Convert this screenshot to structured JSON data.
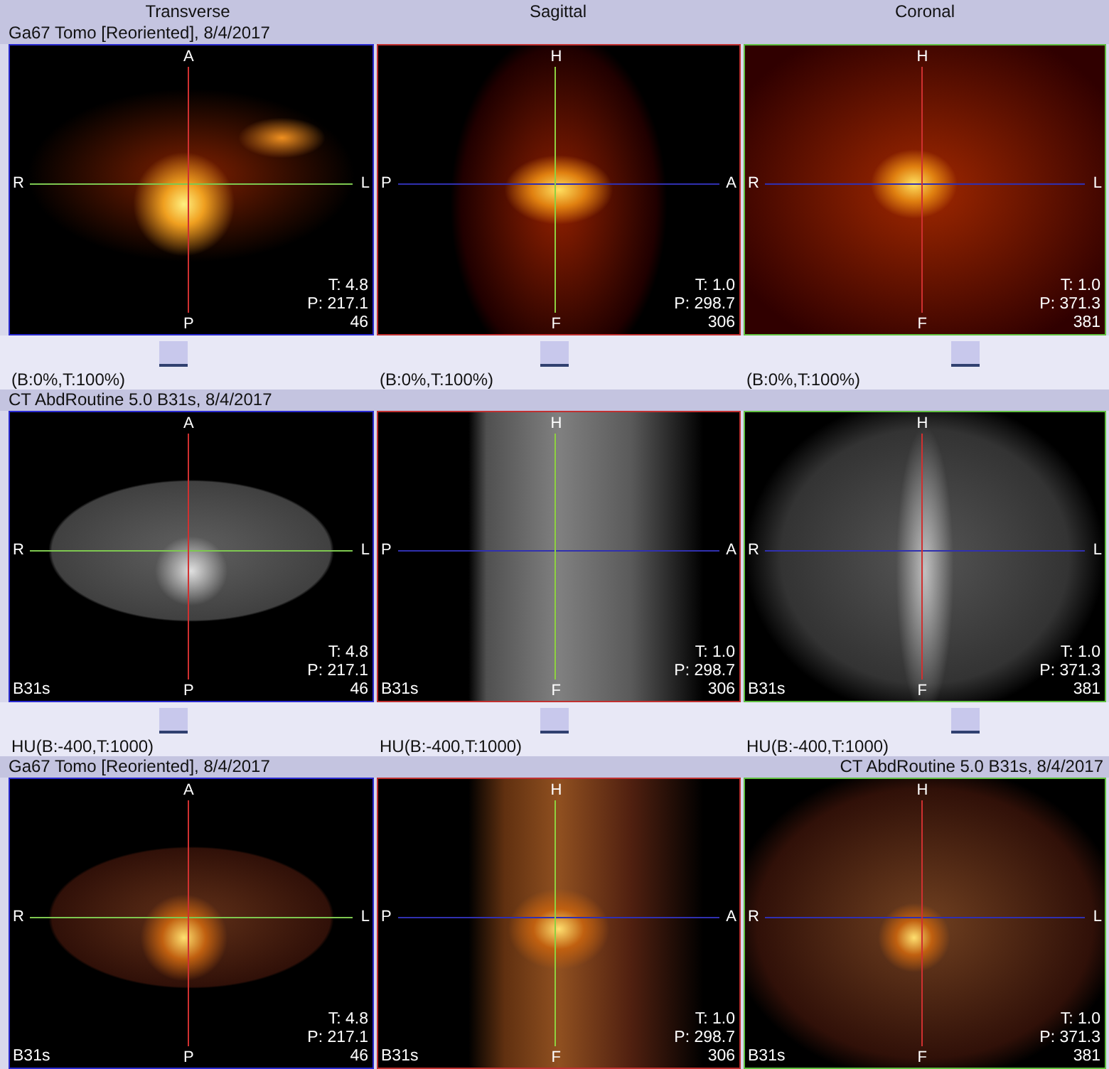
{
  "headers": [
    "Transverse",
    "Sagittal",
    "Coronal"
  ],
  "rows": [
    {
      "kind": "pet",
      "title_left": "Ga67 Tomo [Reoriented], 8/4/2017",
      "views": [
        {
          "kind": "transverse",
          "top": "A",
          "bottom": "P",
          "left": "R",
          "right": "L",
          "t": "T: 4.8",
          "p": "P: 217.1",
          "slice": "46",
          "slider": {
            "level": 0.45
          },
          "window": "(B:0%,T:100%)"
        },
        {
          "kind": "sagittal",
          "top": "H",
          "bottom": "F",
          "left": "P",
          "right": "A",
          "t": "T: 1.0",
          "p": "P: 298.7",
          "slice": "306",
          "slider": {
            "level": 0.49
          },
          "window": "(B:0%,T:100%)"
        },
        {
          "kind": "coronal",
          "top": "H",
          "bottom": "F",
          "left": "R",
          "right": "L",
          "t": "T: 1.0",
          "p": "P: 371.3",
          "slice": "381",
          "slider": {
            "level": 0.61
          },
          "window": "(B:0%,T:100%)"
        }
      ]
    },
    {
      "kind": "ct",
      "title_left": "CT AbdRoutine  5.0  B31s, 8/4/2017",
      "views": [
        {
          "kind": "transverse",
          "top": "A",
          "bottom": "P",
          "left": "R",
          "right": "L",
          "t": "T: 4.8",
          "p": "P: 217.1",
          "slice": "46",
          "series": "B31s",
          "slider": {
            "level": 0.45
          },
          "window": "HU(B:-400,T:1000)"
        },
        {
          "kind": "sagittal",
          "top": "H",
          "bottom": "F",
          "left": "P",
          "right": "A",
          "t": "T: 1.0",
          "p": "P: 298.7",
          "slice": "306",
          "series": "B31s",
          "slider": {
            "level": 0.49
          },
          "window": "HU(B:-400,T:1000)"
        },
        {
          "kind": "coronal",
          "top": "H",
          "bottom": "F",
          "left": "R",
          "right": "L",
          "t": "T: 1.0",
          "p": "P: 371.3",
          "slice": "381",
          "series": "B31s",
          "slider": {
            "level": 0.61
          },
          "window": "HU(B:-400,T:1000)"
        }
      ]
    },
    {
      "kind": "fused",
      "title_left": "Ga67 Tomo [Reoriented], 8/4/2017",
      "title_right": "CT AbdRoutine  5.0  B31s, 8/4/2017",
      "views": [
        {
          "kind": "transverse",
          "top": "A",
          "bottom": "P",
          "left": "R",
          "right": "L",
          "t": "T: 4.8",
          "p": "P: 217.1",
          "slice": "46",
          "series": "B31s"
        },
        {
          "kind": "sagittal",
          "top": "H",
          "bottom": "F",
          "left": "P",
          "right": "A",
          "t": "T: 1.0",
          "p": "P: 298.7",
          "slice": "306",
          "series": "B31s"
        },
        {
          "kind": "coronal",
          "top": "H",
          "bottom": "F",
          "left": "R",
          "right": "L",
          "t": "T: 1.0",
          "p": "P: 371.3",
          "slice": "381",
          "series": "B31s"
        }
      ]
    }
  ]
}
